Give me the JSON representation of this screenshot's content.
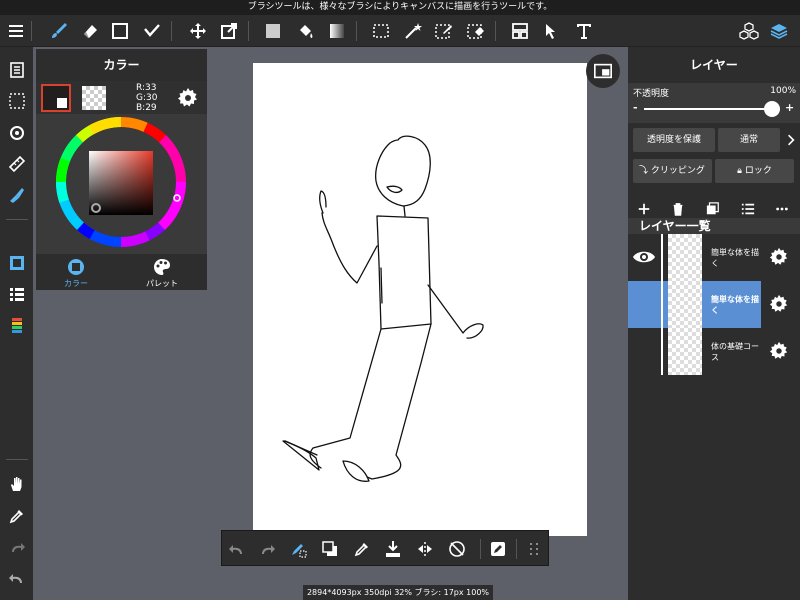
{
  "status_bar": {
    "text": "ブラシツールは、様々なブラシによりキャンバスに描画を行うツールです。"
  },
  "toolbar": {
    "tools": [
      "menu-icon",
      "brush-icon",
      "eraser-icon",
      "shape-icon",
      "fill-shape-icon",
      "move-icon",
      "transform-icon",
      "fill-icon",
      "bucket-icon",
      "gradient-icon",
      "select-icon",
      "magic-wand-icon",
      "select-pen-icon",
      "select-eraser-icon",
      "frame-divider-icon",
      "operation-icon",
      "text-icon",
      "material-icon",
      "layers-icon"
    ]
  },
  "color_panel": {
    "title": "カラー",
    "rgb": {
      "r": "R:33",
      "g": "G:30",
      "b": "B:29"
    },
    "tabs": {
      "color": "カラー",
      "palette": "パレット"
    },
    "colors": {
      "main": "#211e1d",
      "active_tab": "#5ab4f0"
    }
  },
  "layer_panel": {
    "title": "レイヤー",
    "opacity_label": "不透明度",
    "opacity_value": "100%",
    "opacity_level": 1.0,
    "slider_minus": "-",
    "slider_plus": "+",
    "protect_label": "透明度を保護",
    "blend_label": "通常",
    "clipping_label": "クリッピング",
    "lock_label": "ロック",
    "list_title": "レイヤー一覧",
    "layers": [
      {
        "name": "簡単な体を描く",
        "visible": true,
        "selected": false
      },
      {
        "name": "簡単な体を描く",
        "visible": false,
        "selected": true
      },
      {
        "name": "体の基礎コース",
        "visible": false,
        "selected": false
      }
    ],
    "selected_color": "#5a8fd4"
  },
  "bottom_toolbar": {
    "tools": [
      "undo-icon",
      "redo-icon",
      "brush-settings-icon",
      "color-swap-icon",
      "eyedropper-icon",
      "save-icon",
      "flip-icon",
      "snap-icon",
      "edit-icon",
      "grid-icon"
    ]
  },
  "info_bar": {
    "text": "2894*4093px 350dpi 32% ブラシ: 17px 100%"
  }
}
